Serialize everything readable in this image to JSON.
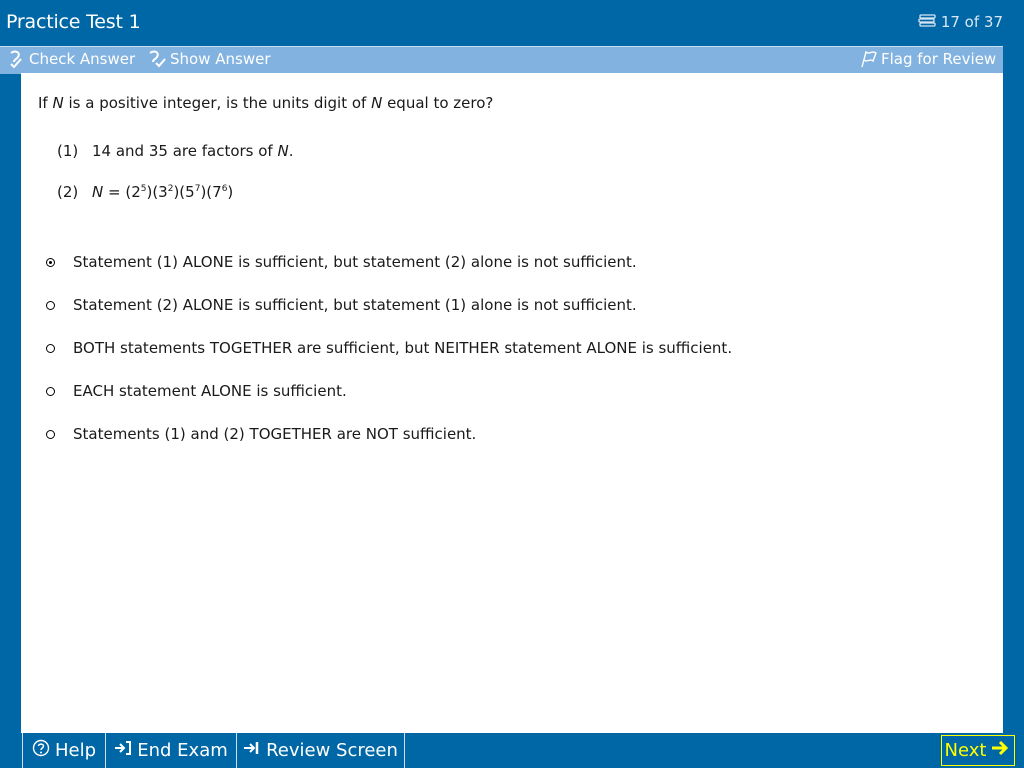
{
  "header": {
    "title": "Practice Test 1",
    "counter": "17 of 37"
  },
  "toolbar": {
    "check_answer": "Check Answer",
    "show_answer": "Show Answer",
    "flag_review": "Flag for Review"
  },
  "question": {
    "text_pre": "If ",
    "var": "N",
    "text_mid": " is a positive integer, is the units digit of ",
    "text_post": " equal to zero?",
    "statements": [
      {
        "num": "(1)",
        "text": "14 and 35 are factors of ",
        "var": "N",
        "end": "."
      },
      {
        "num": "(2)",
        "var": "N",
        "eq": " = (2",
        "e1": "5",
        "p2": ")(3",
        "e2": "2",
        "p3": ")(5",
        "e3": "7",
        "p4": ")(7",
        "e4": "6",
        "p5": ")"
      }
    ]
  },
  "options": [
    {
      "label": "Statement (1) ALONE is sufficient, but statement (2) alone is not sufficient.",
      "selected": true
    },
    {
      "label": "Statement (2) ALONE is sufficient, but statement (1) alone is not sufficient.",
      "selected": false
    },
    {
      "label": "BOTH statements TOGETHER are sufficient, but NEITHER statement ALONE is sufficient.",
      "selected": false
    },
    {
      "label": "EACH statement ALONE is sufficient.",
      "selected": false
    },
    {
      "label": "Statements (1) and (2) TOGETHER are NOT sufficient.",
      "selected": false
    }
  ],
  "bottom": {
    "help": "Help",
    "end_exam": "End Exam",
    "review_screen": "Review Screen",
    "next": "Next"
  },
  "icons": {
    "counter": "list-icon",
    "check": "check-answer-icon",
    "show": "show-answer-icon",
    "flag": "flag-icon",
    "help": "help-icon",
    "end": "end-exam-icon",
    "review": "review-screen-icon",
    "next": "arrow-right-icon"
  },
  "colors": {
    "frame_blue": "#0067a6",
    "toolbar_blue": "#82b2e0",
    "next_yellow": "#ffff00"
  }
}
